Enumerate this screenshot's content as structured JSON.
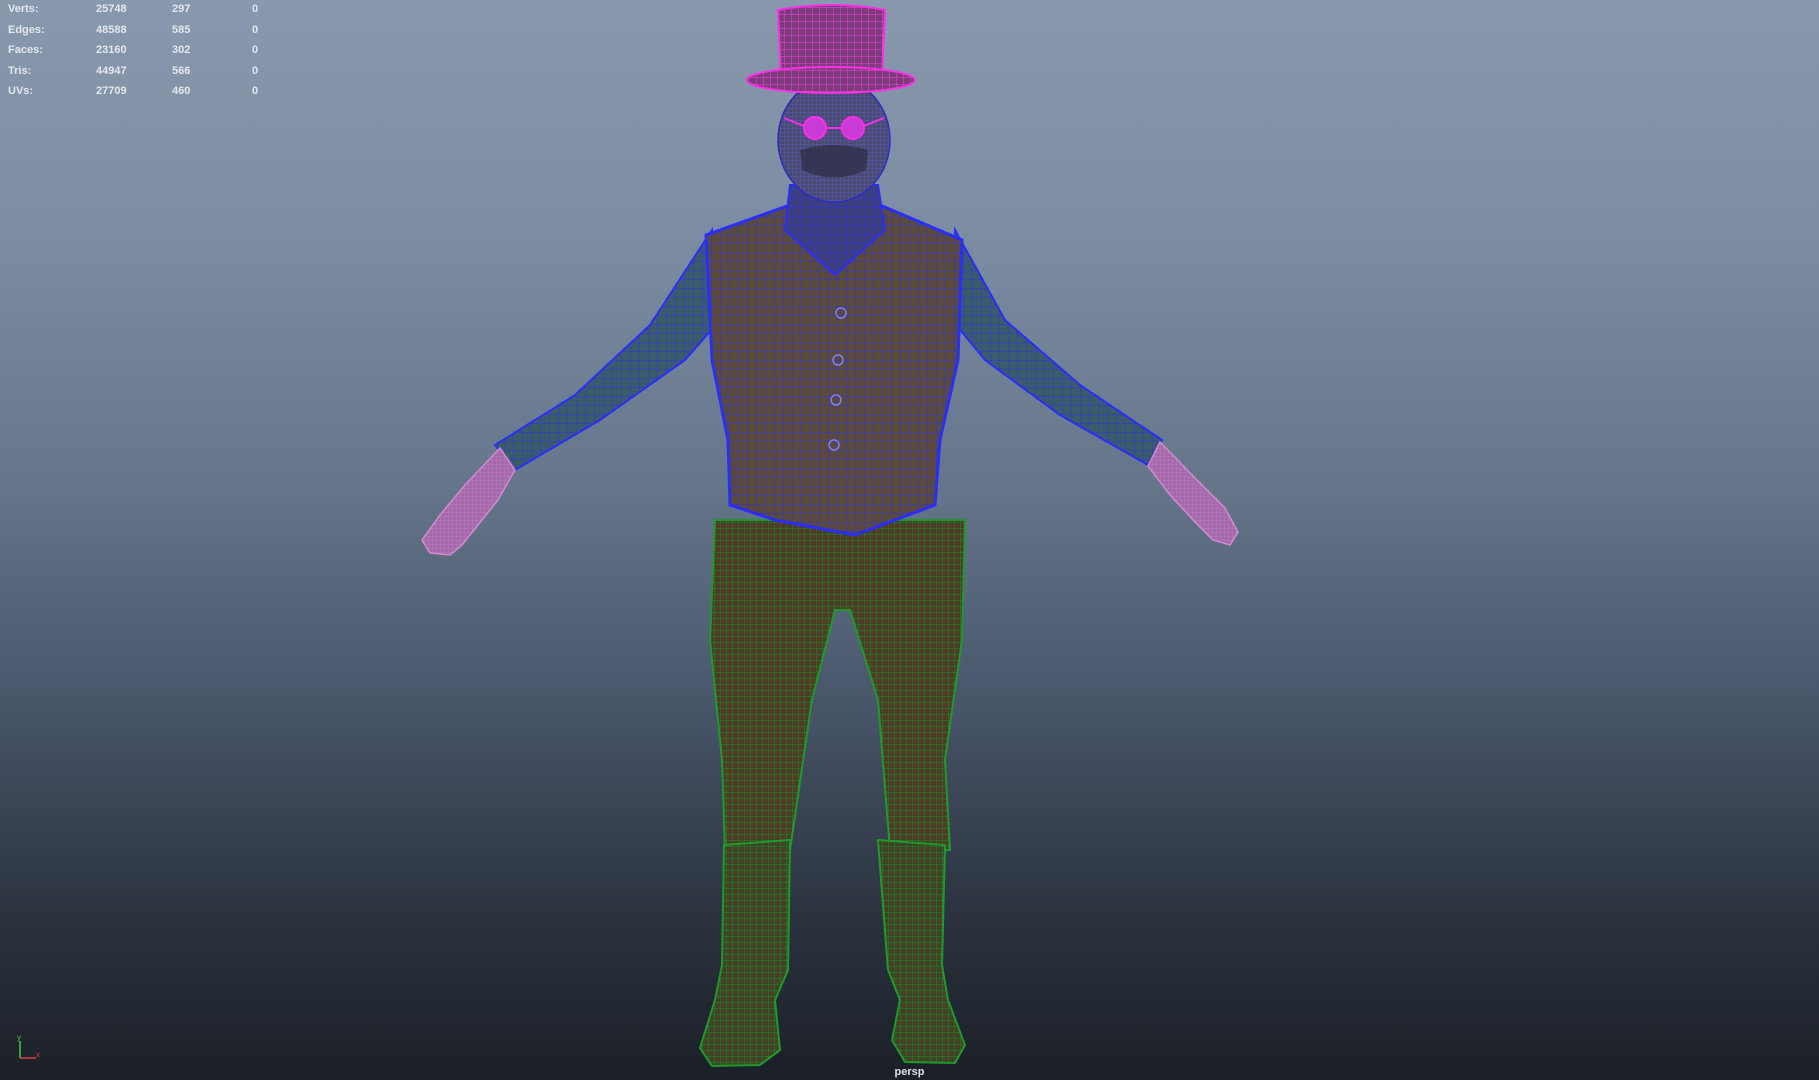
{
  "heads_up_display": {
    "rows": [
      {
        "label": "Verts:",
        "values": [
          "25748",
          "297",
          "0"
        ]
      },
      {
        "label": "Edges:",
        "values": [
          "48588",
          "585",
          "0"
        ]
      },
      {
        "label": "Faces:",
        "values": [
          "23160",
          "302",
          "0"
        ]
      },
      {
        "label": "Tris:",
        "values": [
          "44947",
          "566",
          "0"
        ]
      },
      {
        "label": "UVs:",
        "values": [
          "27709",
          "460",
          "0"
        ]
      }
    ]
  },
  "viewport": {
    "camera_name": "persp",
    "axis_labels": {
      "y": "y",
      "x": "x"
    },
    "background_top": "#8898ad",
    "background_bottom": "#1b1f27",
    "wire_colors": {
      "selected_shirt": "#2a2dff",
      "hat_glasses": "#ff2ee8",
      "pants_boots": "#1d8a2a",
      "hands": "#d28bd0"
    }
  }
}
